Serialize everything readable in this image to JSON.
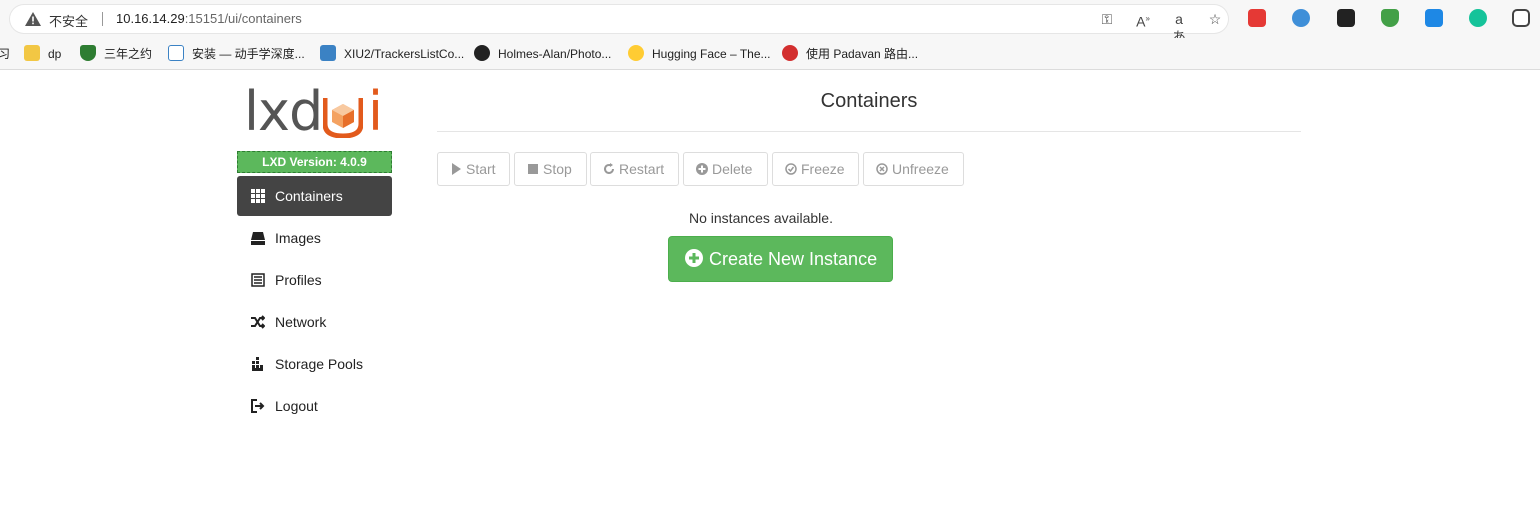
{
  "browser": {
    "insecure_label": "不安全",
    "url_host": "10.16.14.29",
    "url_rest": ":15151/ui/containers",
    "bookmarks": [
      {
        "label": "习",
        "icon": "cut-off-icon"
      },
      {
        "label": "dp",
        "icon": "folder-icon"
      },
      {
        "label": "三年之约",
        "icon": "shield-icon"
      },
      {
        "label": "安装 — 动手学深度...",
        "icon": "book-icon"
      },
      {
        "label": "XIU2/TrackersListCo...",
        "icon": "tracker-icon"
      },
      {
        "label": "Holmes-Alan/Photo...",
        "icon": "github-icon"
      },
      {
        "label": "Hugging Face – The...",
        "icon": "hugging-face-icon"
      },
      {
        "label": "使用 Padavan 路由...",
        "icon": "pi-icon"
      }
    ]
  },
  "app": {
    "logo_text": "lxd",
    "logo_i": "i",
    "version": "LXD Version: 4.0.9",
    "nav": [
      {
        "label": "Containers",
        "icon": "grid-icon",
        "active": true
      },
      {
        "label": "Images",
        "icon": "drive-icon"
      },
      {
        "label": "Profiles",
        "icon": "list-icon"
      },
      {
        "label": "Network",
        "icon": "shuffle-icon"
      },
      {
        "label": "Storage Pools",
        "icon": "storage-icon"
      },
      {
        "label": "Logout",
        "icon": "logout-icon"
      }
    ],
    "title": "Containers",
    "actions": [
      {
        "label": "Start",
        "icon": "play-icon"
      },
      {
        "label": "Stop",
        "icon": "stop-icon"
      },
      {
        "label": "Restart",
        "icon": "refresh-icon"
      },
      {
        "label": "Delete",
        "icon": "delete-icon"
      },
      {
        "label": "Freeze",
        "icon": "check-circle-icon"
      },
      {
        "label": "Unfreeze",
        "icon": "x-circle-icon"
      }
    ],
    "empty_message": "No instances available.",
    "create_label": "Create New Instance"
  },
  "colors": {
    "accent_green": "#5cb85c",
    "nav_active": "#444444",
    "logo_orange": "#e25a1c"
  }
}
